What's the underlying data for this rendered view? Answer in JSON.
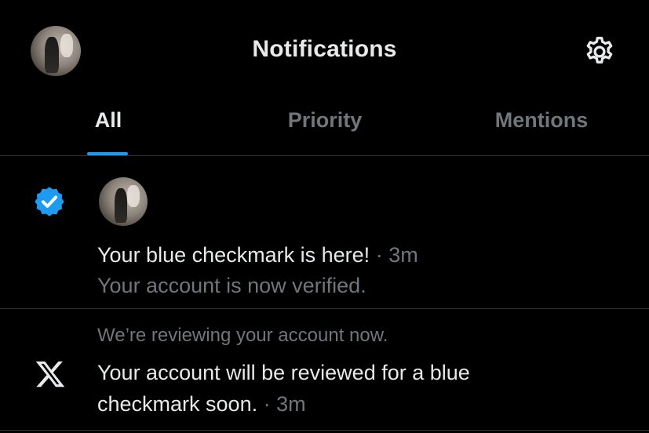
{
  "header": {
    "title": "Notifications",
    "avatar_icon": "profile-avatar",
    "settings_icon": "gear-icon"
  },
  "tabs": [
    {
      "label": "All",
      "active": true
    },
    {
      "label": "Priority",
      "active": false
    },
    {
      "label": "Mentions",
      "active": false
    }
  ],
  "notifications": [
    {
      "icon": "verified-badge-icon",
      "title": "Your blue checkmark is here!",
      "separator": " · ",
      "time": "3m",
      "subtitle": "Your account is now verified."
    },
    {
      "icon": "x-logo-icon",
      "context": "We’re reviewing your account now.",
      "title_line1": "Your account will be reviewed for a blue",
      "title_line2": "checkmark soon.",
      "separator": " · ",
      "time": "3m"
    }
  ],
  "colors": {
    "background": "#000000",
    "text": "#e7e9ea",
    "muted": "#71767b",
    "accent": "#1d9bf0",
    "divider": "#2f3336"
  }
}
